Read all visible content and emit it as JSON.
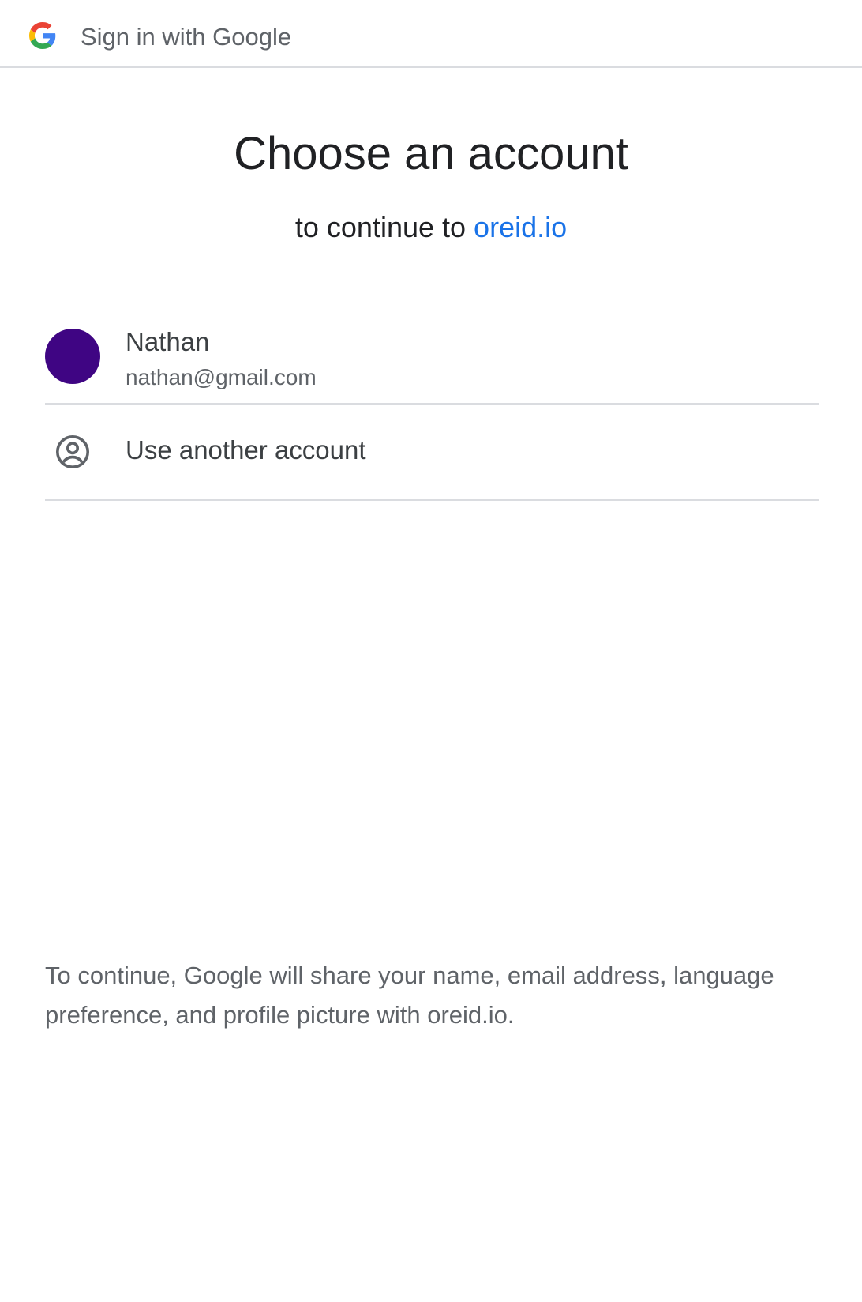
{
  "header": {
    "logo_icon": "google-g-icon",
    "title": "Sign in with Google"
  },
  "main": {
    "title": "Choose an account",
    "subtitle_prefix": "to continue to ",
    "site_name": "oreid.io"
  },
  "accounts": [
    {
      "name": "Nathan",
      "email": "nathan@gmail.com",
      "avatar_color": "#3f0583"
    }
  ],
  "another_account": {
    "icon": "account-circle-icon",
    "label": "Use another account"
  },
  "disclaimer": "To continue, Google will share your name, email address, language preference, and profile picture with oreid.io.",
  "colors": {
    "link": "#1a73e8",
    "text_primary": "#202124",
    "text_secondary": "#5f6368",
    "divider": "#dadce0"
  }
}
